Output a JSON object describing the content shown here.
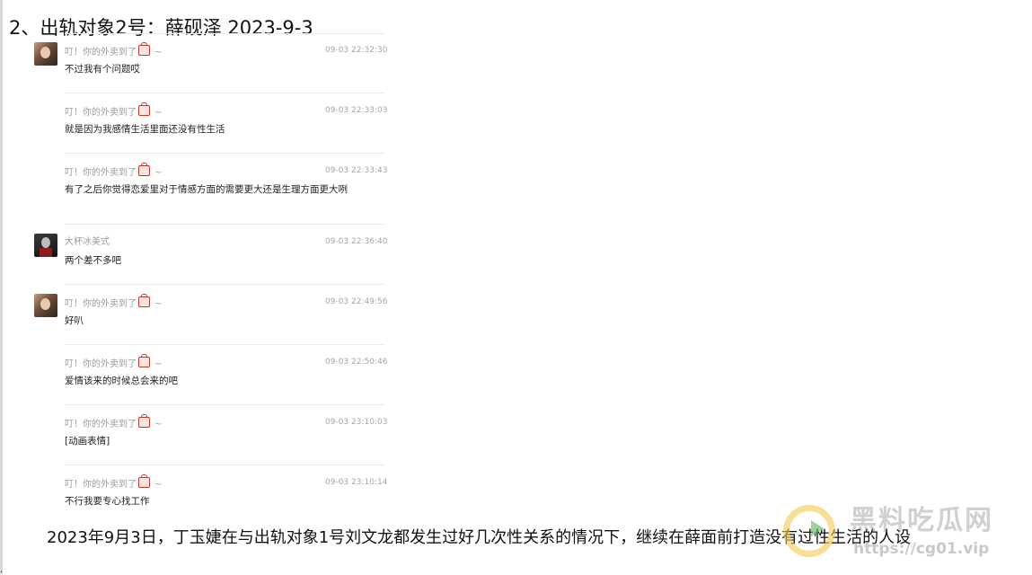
{
  "document": {
    "title": "2、出轨对象2号：薛砚泽  2023-9-3",
    "caption": "2023年9月3日，丁玉婕在与出轨对象1号刘文龙都发生过好几次性关系的情况下，继续在薛面前打造没有过性生活的人设",
    "stray_mark": "."
  },
  "chat": {
    "messages": [
      {
        "sender": "叮！你的外卖到了",
        "sender_suffix": " ~",
        "sender_icon": "takeout-bag-icon",
        "time": "09-03 22:32:30",
        "text": "不过我有个问题哎",
        "avatar": "girl"
      },
      {
        "sender": "叮！你的外卖到了",
        "sender_suffix": " ~",
        "sender_icon": "takeout-bag-icon",
        "time": "09-03 22:33:03",
        "text": "就是因为我感情生活里面还没有性生活",
        "avatar": ""
      },
      {
        "sender": "叮！你的外卖到了",
        "sender_suffix": " ~",
        "sender_icon": "takeout-bag-icon",
        "time": "09-03 22:33:43",
        "text": "有了之后你觉得恋爱里对于情感方面的需要更大还是生理方面更大咧",
        "avatar": ""
      },
      {
        "sender": "大杯冰美式",
        "sender_suffix": "",
        "sender_icon": "",
        "time": "09-03 22:36:40",
        "text": "两个差不多吧",
        "avatar": "boy"
      },
      {
        "sender": "叮！你的外卖到了",
        "sender_suffix": " ~",
        "sender_icon": "takeout-bag-icon",
        "time": "09-03 22:49:56",
        "text": "好叭",
        "avatar": "girl"
      },
      {
        "sender": "叮！你的外卖到了",
        "sender_suffix": " ~",
        "sender_icon": "takeout-bag-icon",
        "time": "09-03 22:50:46",
        "text": "爱情该来的时候总会来的吧",
        "avatar": ""
      },
      {
        "sender": "叮！你的外卖到了",
        "sender_suffix": " ~",
        "sender_icon": "takeout-bag-icon",
        "time": "09-03 23:10:03",
        "text": "[动画表情]",
        "avatar": ""
      },
      {
        "sender": "叮！你的外卖到了",
        "sender_suffix": " ~",
        "sender_icon": "takeout-bag-icon",
        "time": "09-03 23:10:14",
        "text": "不行我要专心找工作",
        "avatar": ""
      }
    ]
  },
  "watermark": {
    "title": "黑料吃瓜网",
    "url": "https://cg01.vip"
  },
  "colors": {
    "name": "#9c9c9c",
    "time": "#a6a6a6",
    "separator": "#ececec",
    "bag_icon": "#c0392b"
  }
}
